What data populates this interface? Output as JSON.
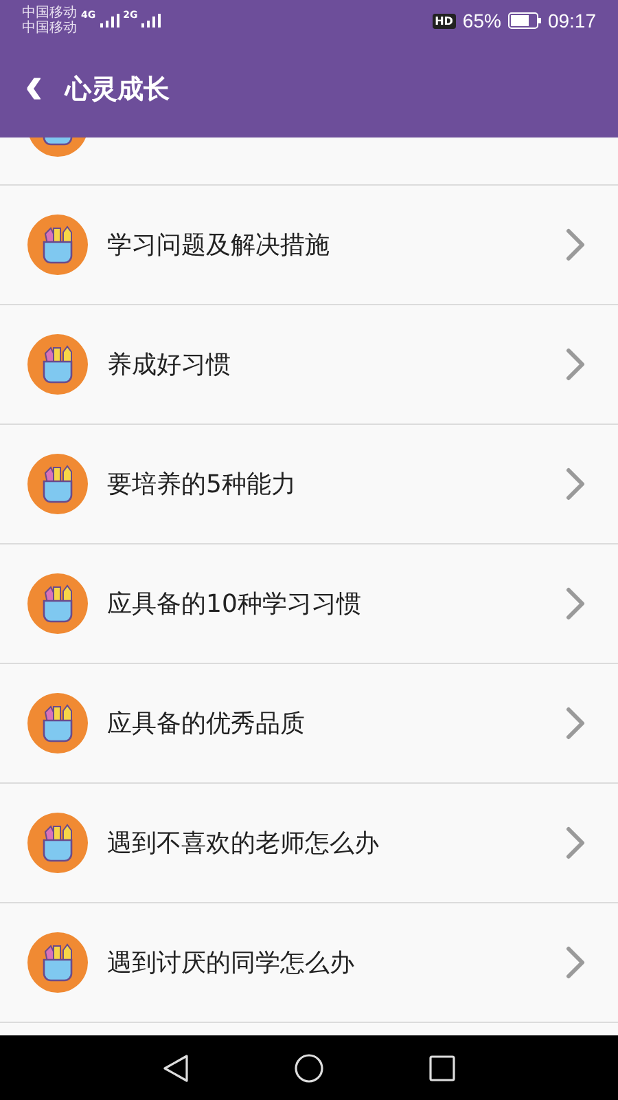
{
  "status_bar": {
    "carriers": [
      "中国移动",
      "中国移动"
    ],
    "networks": [
      "4G",
      "2G"
    ],
    "hd": "HD",
    "battery": "65%",
    "time": "09:17"
  },
  "app_bar": {
    "back": "‹",
    "title": "心灵成长"
  },
  "list": {
    "items": [
      {
        "kind": "partial"
      },
      {
        "kind": "row",
        "label": "学习问题及解决措施"
      },
      {
        "kind": "row",
        "label": "养成好习惯"
      },
      {
        "kind": "row",
        "label": "要培养的5种能力"
      },
      {
        "kind": "row",
        "label": "应具备的10种学习习惯"
      },
      {
        "kind": "row",
        "label": "应具备的优秀品质"
      },
      {
        "kind": "row",
        "label": "遇到不喜欢的老师怎么办"
      },
      {
        "kind": "row",
        "label": "遇到讨厌的同学怎么办"
      }
    ]
  }
}
